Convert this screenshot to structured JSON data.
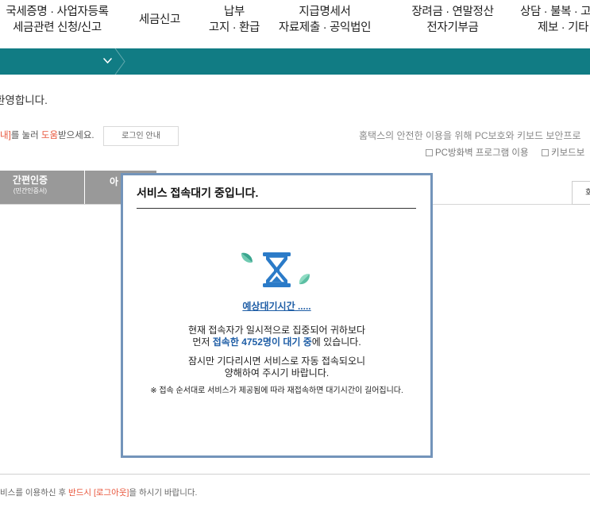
{
  "top_nav": {
    "items": [
      {
        "line1": "국세증명 · 사업자등록",
        "line2": "세금관련 신청/신고"
      },
      {
        "line1": "세금신고"
      },
      {
        "line1": "납부",
        "line2": "고지 · 환급"
      },
      {
        "line1": "지급명세서",
        "line2": "자료제출 · 공익법인"
      },
      {
        "line1": "장려금 · 연말정산",
        "line2": "전자기부금"
      },
      {
        "line1": "상담 · 불복 · 고",
        "line2": "제보 · 기타"
      }
    ]
  },
  "sub_bar": {
    "dropdown_icon": "chevron-down-icon",
    "separator_icon": "chevron-right-icon"
  },
  "login": {
    "welcome": "환영합니다.",
    "help": {
      "part1": "내]",
      "part2": "를 눌러 ",
      "part3": "도움",
      "part4": "받으세요."
    },
    "guide_button": "로그인 안내",
    "security_notice": "홈택스의 안전한 이용을 위해 PC보호와 키보드 보안프로",
    "options": [
      {
        "label": "PC방화벽 프로그램 이용",
        "checked": false
      },
      {
        "label": "키보드보",
        "checked": false
      }
    ],
    "tabs": [
      {
        "label": "간편인증",
        "sublabel": "(민간인증서)"
      },
      {
        "label": "아"
      }
    ],
    "side_button": "회",
    "logout_notice": {
      "part1": "비스를 이용하신 후 ",
      "part2": "반드시 [로그아웃]",
      "part3": "을 하시기 바랍니다."
    }
  },
  "modal": {
    "title": "서비스 접속대기 중입니다.",
    "icon": "hourglass-icon",
    "eta_label": "예상대기시간 .....",
    "message_line1": "현재 접속자가 일시적으로 집중되어 귀하보다",
    "message_line2": {
      "pre": "먼저 ",
      "emph": "접속한 4752명이 대기 중",
      "post": "에 있습니다."
    },
    "message_line3": "잠시만 기다리시면 서비스로 자동 접속되오니",
    "message_line4": "양해하여 주시기 바랍니다.",
    "note": "※ 접속 순서대로 서비스가 제공됨에 따라 재접속하면 대기시간이 길어집니다."
  },
  "colors": {
    "brand_teal": "#117c84",
    "accent_red": "#e8553b",
    "link_blue": "#1f5ea6",
    "modal_border": "#7394ba",
    "tab_gray": "#999999",
    "hourglass_blue": "#2b7bc8",
    "leaf_green": "#3aa58e"
  }
}
